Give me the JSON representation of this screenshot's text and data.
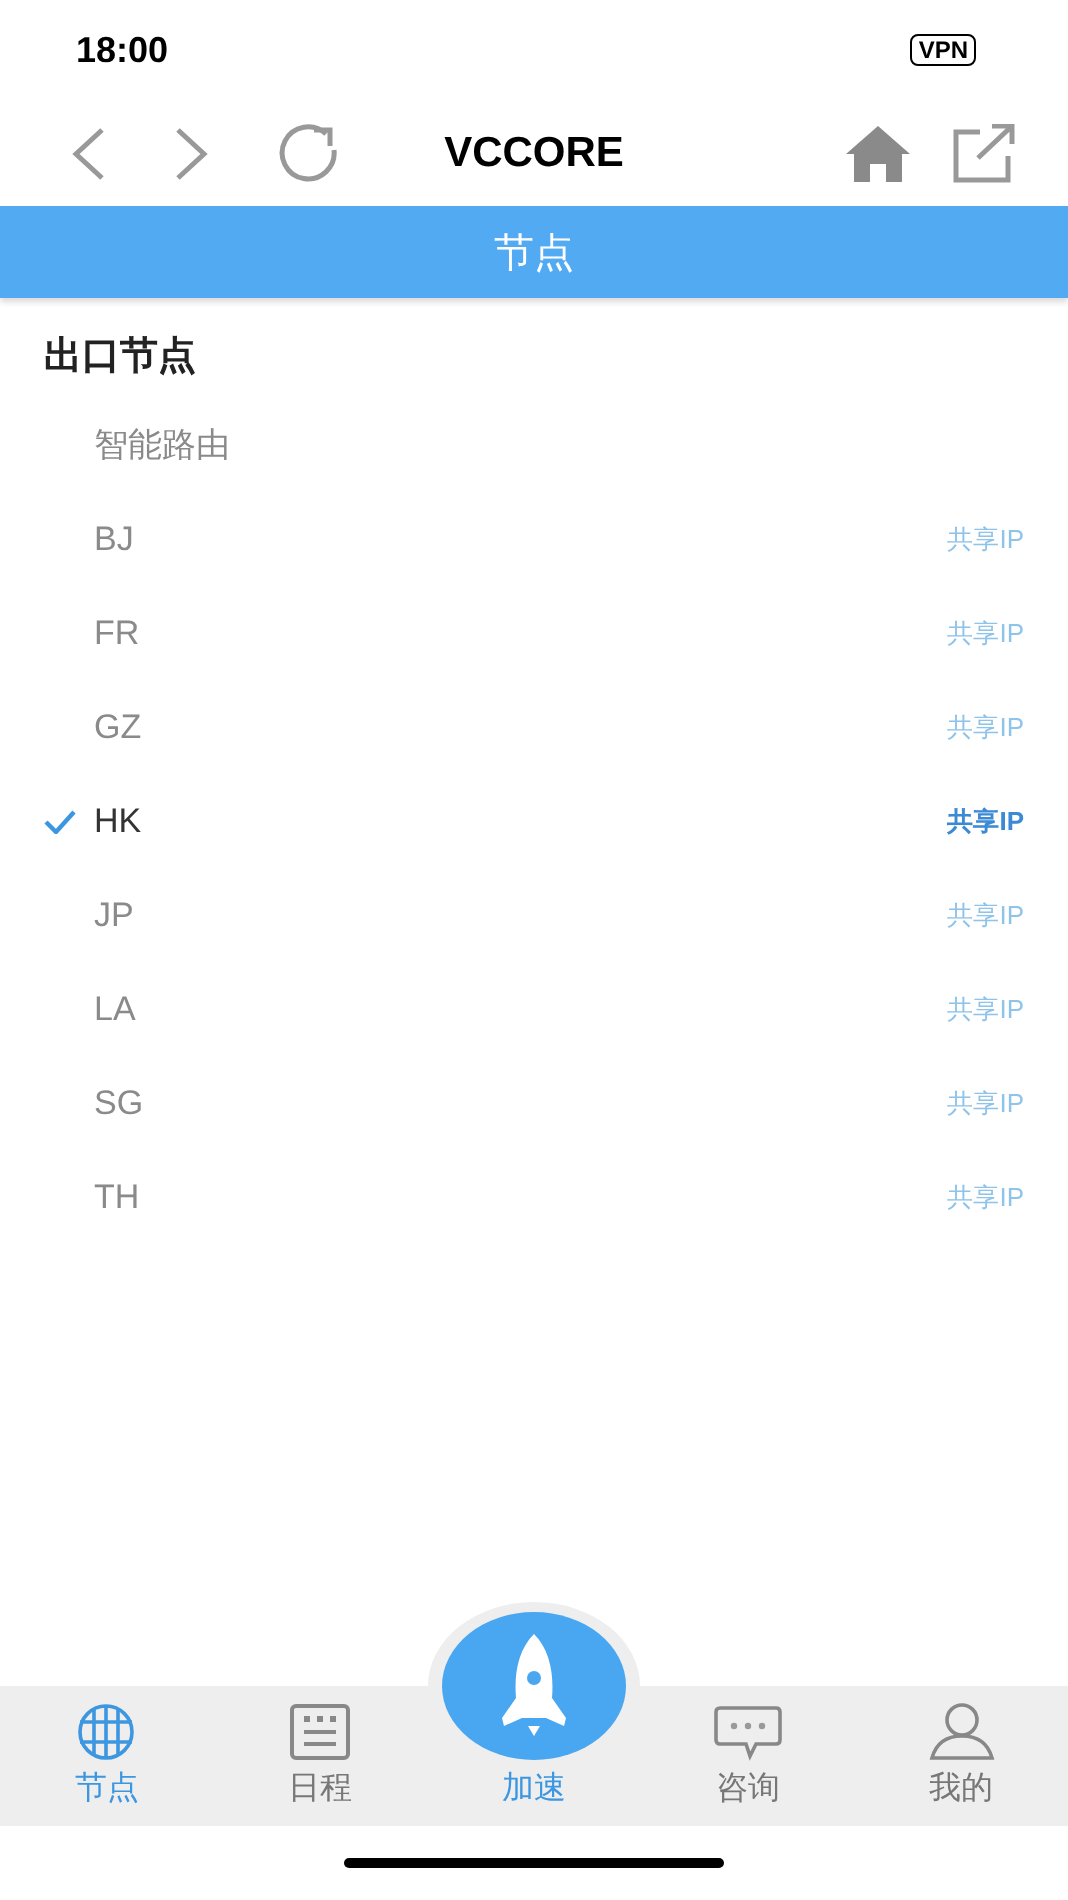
{
  "status_bar": {
    "time": "18:00",
    "vpn": "VPN"
  },
  "toolbar": {
    "title": "VCCORE"
  },
  "header": {
    "title": "节点"
  },
  "section": {
    "title": "出口节点"
  },
  "nodes": [
    {
      "name": "智能路由",
      "selected": false
    },
    {
      "name": "BJ",
      "tag": "共享IP",
      "selected": false
    },
    {
      "name": "FR",
      "tag": "共享IP",
      "selected": false
    },
    {
      "name": "GZ",
      "tag": "共享IP",
      "selected": false
    },
    {
      "name": "HK",
      "tag": "共享IP",
      "selected": true
    },
    {
      "name": "JP",
      "tag": "共享IP",
      "selected": false
    },
    {
      "name": "LA",
      "tag": "共享IP",
      "selected": false
    },
    {
      "name": "SG",
      "tag": "共享IP",
      "selected": false
    },
    {
      "name": "TH",
      "tag": "共享IP",
      "selected": false
    }
  ],
  "tab_bar": [
    {
      "label": "节点",
      "kind": "globe",
      "selected": true
    },
    {
      "label": "日程",
      "kind": "calendar",
      "selected": false
    },
    {
      "label": "加速",
      "kind": "rocket",
      "selected": true
    },
    {
      "label": "咨询",
      "kind": "chat",
      "selected": false
    },
    {
      "label": "我的",
      "kind": "person",
      "selected": false
    }
  ]
}
